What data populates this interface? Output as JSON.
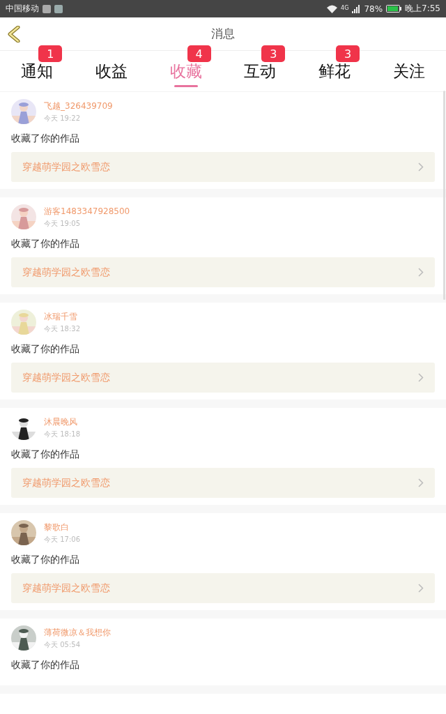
{
  "status_bar": {
    "carrier": "中国移动",
    "network": "4G",
    "battery": "78%",
    "time": "晚上7:55"
  },
  "header": {
    "title": "消息"
  },
  "tabs": [
    {
      "label": "通知",
      "badge": "1",
      "selected": false
    },
    {
      "label": "收益",
      "selected": false
    },
    {
      "label": "收藏",
      "badge": "4",
      "selected": true
    },
    {
      "label": "互动",
      "badge": "3",
      "selected": false
    },
    {
      "label": "鲜花",
      "badge": "3",
      "selected": false
    },
    {
      "label": "关注",
      "selected": false
    }
  ],
  "messages": [
    {
      "user": "飞越_326439709",
      "time": "今天 19:22",
      "action": "收藏了你的作品",
      "work": "穿越萌学园之欧雪恋"
    },
    {
      "user": "游客1483347928500",
      "time": "今天 19:05",
      "action": "收藏了你的作品",
      "work": "穿越萌学园之欧雪恋"
    },
    {
      "user": "冰瑞千雪",
      "time": "今天 18:32",
      "action": "收藏了你的作品",
      "work": "穿越萌学园之欧雪恋"
    },
    {
      "user": "沐晨晚风",
      "time": "今天 18:18",
      "action": "收藏了你的作品",
      "work": "穿越萌学园之欧雪恋"
    },
    {
      "user": "黎歌白",
      "time": "今天 17:06",
      "action": "收藏了你的作品",
      "work": "穿越萌学园之欧雪恋"
    },
    {
      "user": "薄荷微凉＆我想你",
      "time": "今天 05:54",
      "action": "收藏了你的作品"
    }
  ]
}
